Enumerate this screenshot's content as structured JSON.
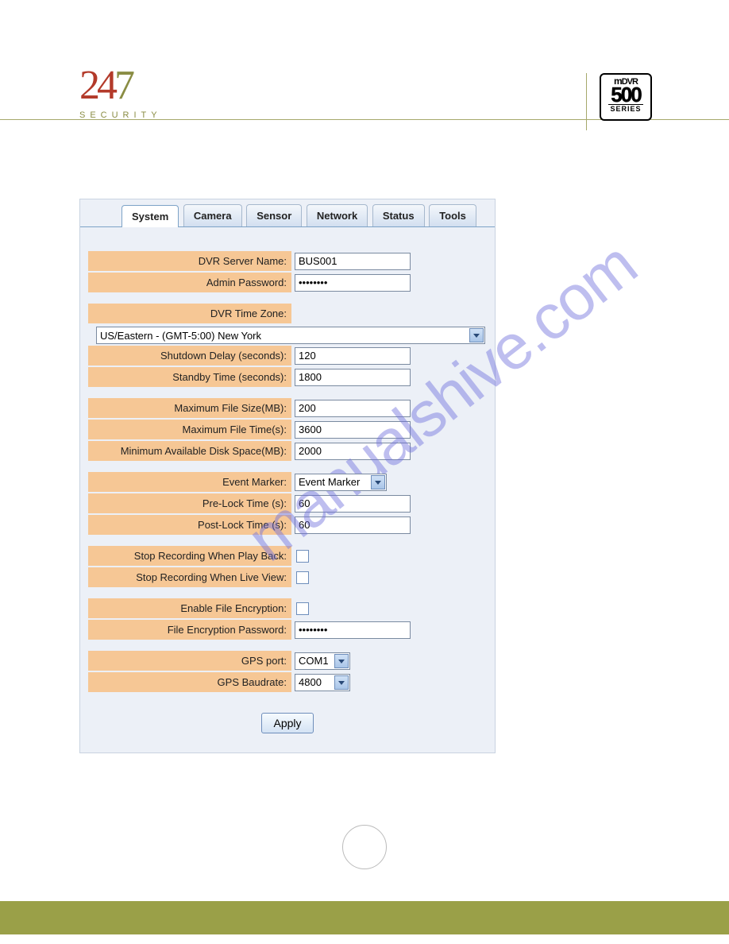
{
  "header": {
    "brand_24": "24",
    "brand_7": "7",
    "brand_sub": "SECURITY",
    "dvr_line1_m": "m",
    "dvr_line1": "DVR",
    "dvr_line2": "500",
    "dvr_line3": "SERIES"
  },
  "watermark": "manualshive.com",
  "tabs": {
    "system": "System",
    "camera": "Camera",
    "sensor": "Sensor",
    "network": "Network",
    "status": "Status",
    "tools": "Tools"
  },
  "labels": {
    "dvr_server_name": "DVR Server Name:",
    "admin_password": "Admin Password:",
    "dvr_time_zone": "DVR Time Zone:",
    "shutdown_delay": "Shutdown Delay (seconds):",
    "standby_time": "Standby Time (seconds):",
    "max_file_size": "Maximum File Size(MB):",
    "max_file_time": "Maximum File Time(s):",
    "min_disk_space": "Minimum Available Disk Space(MB):",
    "event_marker": "Event Marker:",
    "pre_lock": "Pre-Lock Time (s):",
    "post_lock": "Post-Lock Time (s):",
    "stop_playback": "Stop Recording When Play Back:",
    "stop_liveview": "Stop Recording When Live View:",
    "enable_enc": "Enable File Encryption:",
    "enc_password": "File Encryption Password:",
    "gps_port": "GPS port:",
    "gps_baud": "GPS Baudrate:"
  },
  "values": {
    "dvr_server_name": "BUS001",
    "admin_password": "••••••••",
    "time_zone": "US/Eastern - (GMT-5:00) New York",
    "shutdown_delay": "120",
    "standby_time": "1800",
    "max_file_size": "200",
    "max_file_time": "3600",
    "min_disk_space": "2000",
    "event_marker": "Event Marker",
    "pre_lock": "60",
    "post_lock": "60",
    "enc_password": "••••••••",
    "gps_port": "COM1",
    "gps_baud": "4800"
  },
  "buttons": {
    "apply": "Apply"
  }
}
